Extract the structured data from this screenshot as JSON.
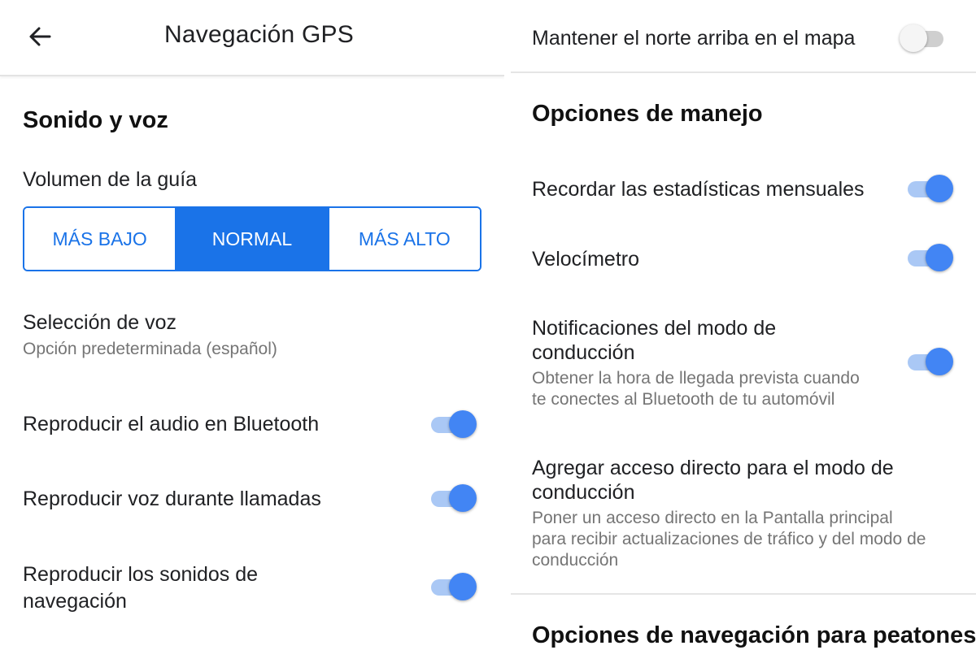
{
  "header": {
    "title": "Navegación GPS",
    "back_icon": "arrow-back-icon"
  },
  "sound_voice": {
    "section_title": "Sonido y voz",
    "volume_label": "Volumen de la guía",
    "volume_options": [
      "MÁS BAJO",
      "NORMAL",
      "MÁS ALTO"
    ],
    "volume_selected": "NORMAL",
    "voice_selection": {
      "title": "Selección de voz",
      "subtitle": "Opción predeterminada (español)"
    },
    "toggles": [
      {
        "title": "Reproducir el audio en Bluetooth",
        "on": true
      },
      {
        "title": "Reproducir voz durante llamadas",
        "on": true
      },
      {
        "title_line1": "Reproducir los sonidos de",
        "title_line2": "navegación",
        "on": true
      }
    ]
  },
  "north_up": {
    "title": "Mantener el norte arriba en el mapa",
    "on": false
  },
  "driving": {
    "section_title": "Opciones de manejo",
    "monthly_stats": {
      "title": "Recordar las estadísticas mensuales",
      "on": true
    },
    "speedometer": {
      "title": "Velocímetro",
      "on": true
    },
    "driving_notifications": {
      "title_line1": "Notificaciones del modo de",
      "title_line2": "conducción",
      "sub_line1": "Obtener la hora de llegada prevista cuando",
      "sub_line2": "te conectes al Bluetooth de tu automóvil",
      "on": true
    },
    "shortcut": {
      "title_line1": "Agregar acceso directo para el modo de",
      "title_line2": "conducción",
      "sub_line1": "Poner un acceso directo en la Pantalla principal",
      "sub_line2": "para recibir actualizaciones de tráfico y del modo de",
      "sub_line3": "conducción"
    }
  },
  "walking": {
    "section_title": "Opciones de navegación para peatones"
  },
  "colors": {
    "accent": "#1a73e8",
    "toggle_on": "#4285f4",
    "toggle_on_track": "#aac8f5",
    "toggle_off_track": "#cfcfcf"
  }
}
